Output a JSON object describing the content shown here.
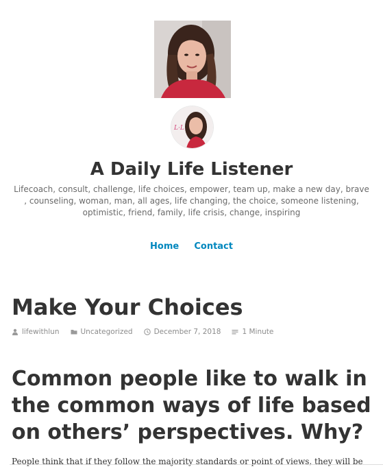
{
  "site": {
    "title": "A Daily Life Listener",
    "description": "Lifecoach, consult, challenge, life choices, empower, team up, make a new day, brave , counseling, woman, man, all ages, life changing, the choice, someone listening, optimistic, friend, family, life crisis, change, inspiring",
    "avatar_initials": "L·L"
  },
  "nav": {
    "items": [
      {
        "label": "Home"
      },
      {
        "label": "Contact"
      }
    ]
  },
  "post": {
    "title": "Make Your Choices",
    "meta": {
      "author": "lifewithlun",
      "category": "Uncategorized",
      "date": "December 7, 2018",
      "reading_time": "1 Minute"
    },
    "subheading": "Common people like to walk in the common ways of life based on others’ perspectives. Why?",
    "body_first_line": "People think that if they follow the majority standards or point of views, they will be"
  },
  "colors": {
    "link": "#0087be",
    "text": "#333333",
    "muted": "#8c8c8c",
    "shirt": "#c8283e"
  },
  "icons": {
    "author": "person-icon",
    "category": "folder-icon",
    "date": "clock-icon",
    "reading_time": "lines-icon"
  }
}
